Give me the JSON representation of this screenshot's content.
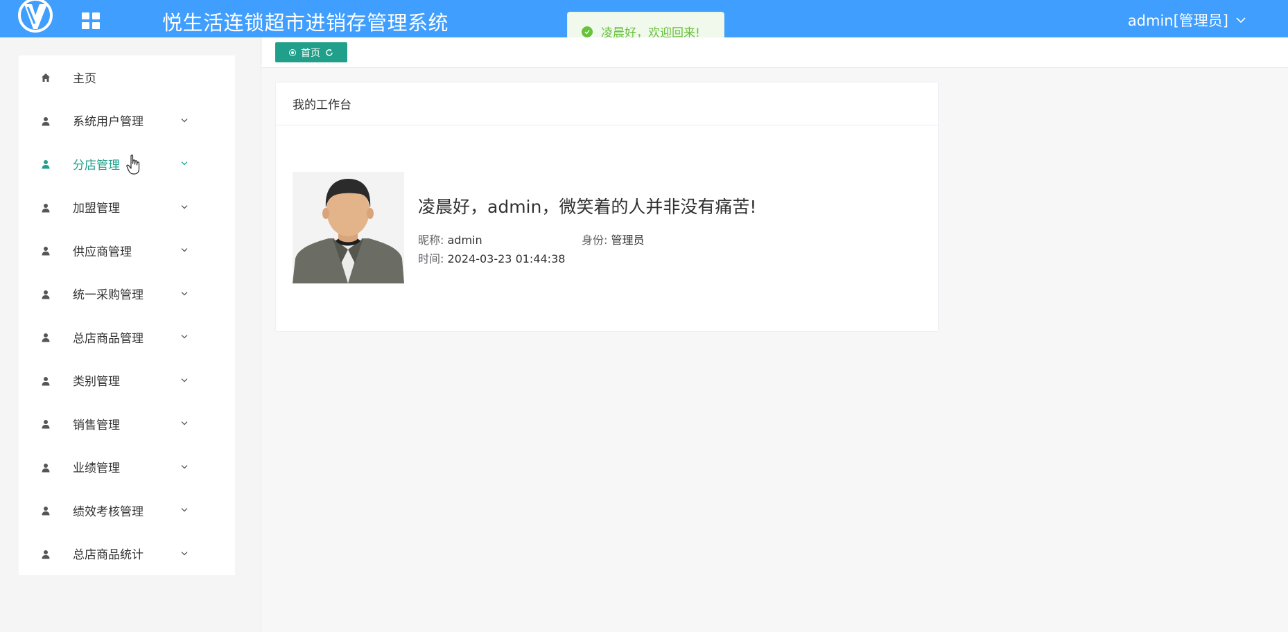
{
  "header": {
    "title": "悦生活连锁超市进销存管理系统",
    "user": "admin[管理员]"
  },
  "toast": {
    "message": "凌晨好，欢迎回来!"
  },
  "sidebar": {
    "items": [
      {
        "label": "主页",
        "icon": "home-icon"
      },
      {
        "label": "系统用户管理",
        "icon": "user-icon"
      },
      {
        "label": "分店管理",
        "icon": "user-icon"
      },
      {
        "label": "加盟管理",
        "icon": "user-icon"
      },
      {
        "label": "供应商管理",
        "icon": "user-icon"
      },
      {
        "label": "统一采购管理",
        "icon": "user-icon"
      },
      {
        "label": "总店商品管理",
        "icon": "user-icon"
      },
      {
        "label": "类别管理",
        "icon": "user-icon"
      },
      {
        "label": "销售管理",
        "icon": "user-icon"
      },
      {
        "label": "业绩管理",
        "icon": "user-icon"
      },
      {
        "label": "绩效考核管理",
        "icon": "user-icon"
      },
      {
        "label": "总店商品统计",
        "icon": "user-icon"
      }
    ],
    "active": "分店管理"
  },
  "tabs": {
    "home": "首页"
  },
  "workbench": {
    "title": "我的工作台",
    "greeting": "凌晨好，admin，微笑着的人并非没有痛苦!",
    "nickname_label": "昵称:",
    "nickname": "admin",
    "role_label": "身份:",
    "role": "管理员",
    "time_label": "时间:",
    "time": "2024-03-23 01:44:38"
  },
  "colors": {
    "header": "#409efe",
    "accent": "#20a08a",
    "toast_text": "#67c23a"
  }
}
